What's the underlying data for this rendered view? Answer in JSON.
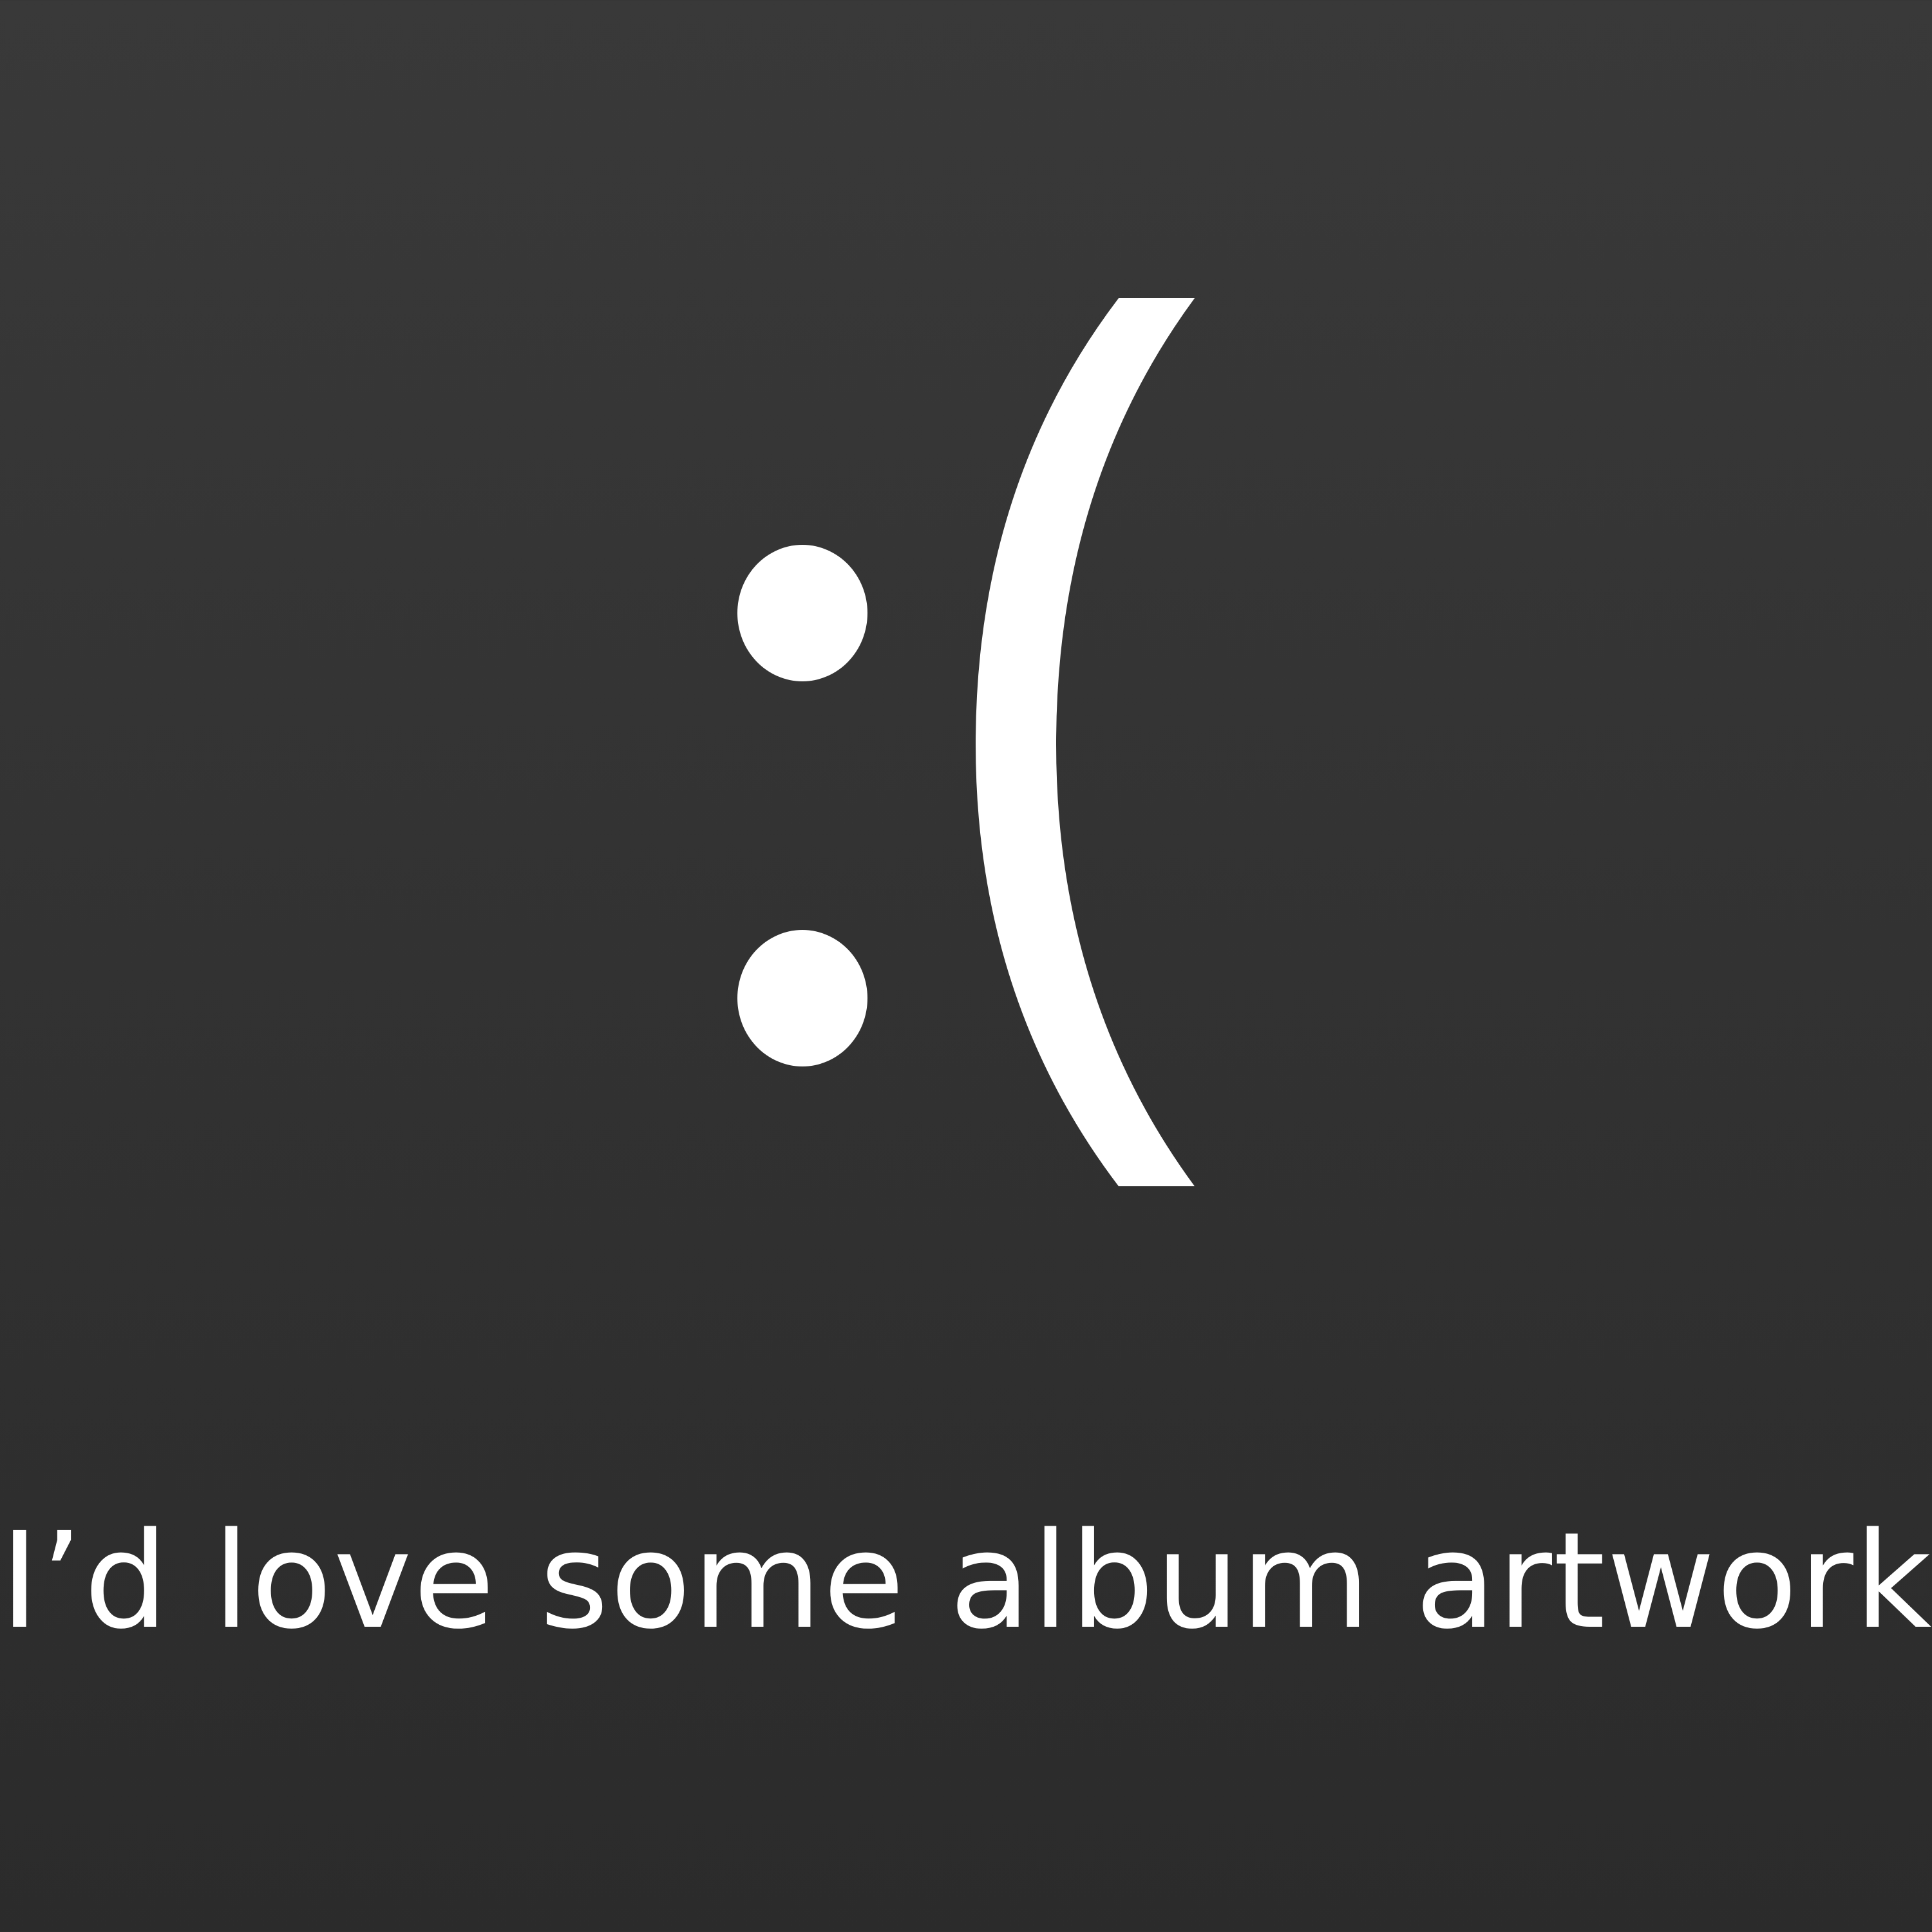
{
  "artwork": {
    "emoticon_text": ":(",
    "caption": "I’d love some album artwork.",
    "colors": {
      "background_top": "#393939",
      "background_bottom": "#2b2b2b",
      "foreground": "#ffffff"
    }
  }
}
